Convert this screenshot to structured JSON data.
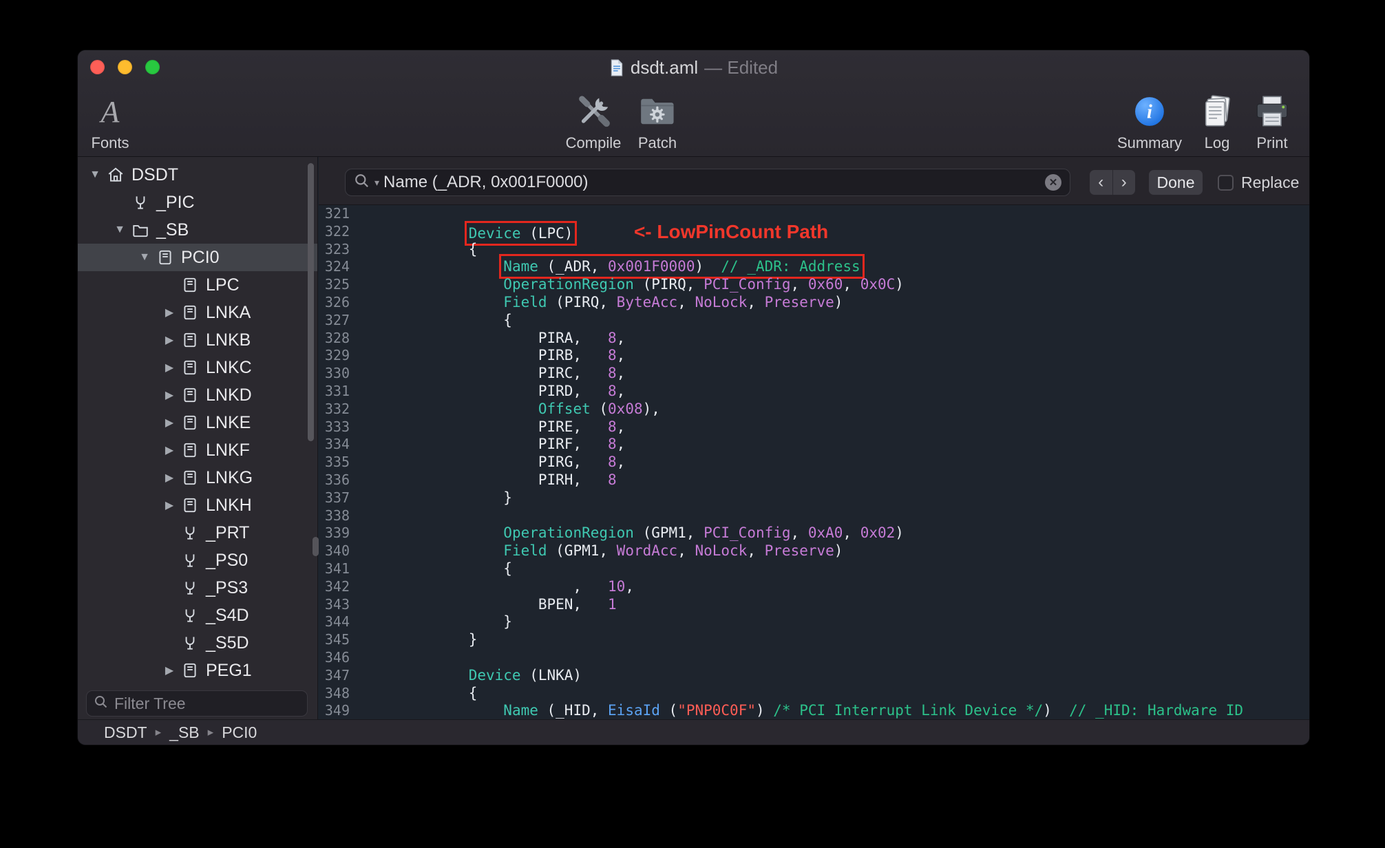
{
  "window": {
    "filename": "dsdt.aml",
    "edited_suffix": "— Edited"
  },
  "toolbar": {
    "fonts": "Fonts",
    "compile": "Compile",
    "patch": "Patch",
    "summary": "Summary",
    "log": "Log",
    "print": "Print"
  },
  "findbar": {
    "query": "Name (_ADR, 0x001F0000)",
    "done": "Done",
    "replace": "Replace",
    "replace_checked": false
  },
  "icons": {
    "search_caret": "▾",
    "clear": "✕",
    "find_prev": "‹",
    "find_next": "›",
    "disclosure_open": "▼",
    "disclosure_closed": "▶",
    "crumb_separator": "▸",
    "fonts_glyph": "A"
  },
  "sidebar": {
    "filter_placeholder": "Filter Tree",
    "breadcrumb": [
      "DSDT",
      "_SB",
      "PCI0"
    ],
    "items": [
      {
        "label": "DSDT",
        "level": 0,
        "disclosure": "open",
        "icon": "house-icon",
        "selected": false
      },
      {
        "label": "_PIC",
        "level": 1,
        "disclosure": "none",
        "icon": "method-icon",
        "selected": false
      },
      {
        "label": "_SB",
        "level": 1,
        "disclosure": "open",
        "icon": "folder-icon",
        "selected": false
      },
      {
        "label": "PCI0",
        "level": 2,
        "disclosure": "open",
        "icon": "device-icon",
        "selected": true
      },
      {
        "label": "LPC",
        "level": 3,
        "disclosure": "none",
        "icon": "device-icon",
        "selected": false
      },
      {
        "label": "LNKA",
        "level": 3,
        "disclosure": "closed",
        "icon": "device-icon",
        "selected": false
      },
      {
        "label": "LNKB",
        "level": 3,
        "disclosure": "closed",
        "icon": "device-icon",
        "selected": false
      },
      {
        "label": "LNKC",
        "level": 3,
        "disclosure": "closed",
        "icon": "device-icon",
        "selected": false
      },
      {
        "label": "LNKD",
        "level": 3,
        "disclosure": "closed",
        "icon": "device-icon",
        "selected": false
      },
      {
        "label": "LNKE",
        "level": 3,
        "disclosure": "closed",
        "icon": "device-icon",
        "selected": false
      },
      {
        "label": "LNKF",
        "level": 3,
        "disclosure": "closed",
        "icon": "device-icon",
        "selected": false
      },
      {
        "label": "LNKG",
        "level": 3,
        "disclosure": "closed",
        "icon": "device-icon",
        "selected": false
      },
      {
        "label": "LNKH",
        "level": 3,
        "disclosure": "closed",
        "icon": "device-icon",
        "selected": false
      },
      {
        "label": "_PRT",
        "level": 3,
        "disclosure": "none",
        "icon": "method-icon",
        "selected": false
      },
      {
        "label": "_PS0",
        "level": 3,
        "disclosure": "none",
        "icon": "method-icon",
        "selected": false
      },
      {
        "label": "_PS3",
        "level": 3,
        "disclosure": "none",
        "icon": "method-icon",
        "selected": false
      },
      {
        "label": "_S4D",
        "level": 3,
        "disclosure": "none",
        "icon": "method-icon",
        "selected": false
      },
      {
        "label": "_S5D",
        "level": 3,
        "disclosure": "none",
        "icon": "method-icon",
        "selected": false
      },
      {
        "label": "PEG1",
        "level": 3,
        "disclosure": "closed",
        "icon": "device-icon",
        "selected": false
      }
    ]
  },
  "editor": {
    "colors": {
      "keyword": "#3fc8b1",
      "constant": "#c67bd6",
      "comment": "#2cc18a",
      "string": "#ff5d55",
      "operator": "#5ba2f2",
      "highlight_box": "#e3271e",
      "annotation": "#f1372b"
    },
    "lines": [
      {
        "n": 321,
        "segs": []
      },
      {
        "n": 322,
        "segs": [
          {
            "t": "            "
          },
          {
            "c": "redbox",
            "segs": [
              {
                "t": "Device",
                "c": "kw"
              },
              {
                "t": " (LPC)"
              }
            ]
          },
          {
            "t": "       "
          },
          {
            "t": "<- LowPinCount Path",
            "c": "ann"
          }
        ]
      },
      {
        "n": 323,
        "segs": [
          {
            "t": "            {"
          }
        ]
      },
      {
        "n": 324,
        "segs": [
          {
            "t": "                "
          },
          {
            "c": "redbox",
            "segs": [
              {
                "t": "Name",
                "c": "kw"
              },
              {
                "t": " (_ADR, "
              },
              {
                "t": "0x001F0000",
                "c": "const"
              },
              {
                "t": ")  "
              },
              {
                "t": "// _ADR: Address",
                "c": "cm"
              }
            ]
          }
        ]
      },
      {
        "n": 325,
        "segs": [
          {
            "t": "                "
          },
          {
            "t": "OperationRegion",
            "c": "kw"
          },
          {
            "t": " (PIRQ, "
          },
          {
            "t": "PCI_Config",
            "c": "const"
          },
          {
            "t": ", "
          },
          {
            "t": "0x60",
            "c": "const"
          },
          {
            "t": ", "
          },
          {
            "t": "0x0C",
            "c": "const"
          },
          {
            "t": ")"
          }
        ]
      },
      {
        "n": 326,
        "segs": [
          {
            "t": "                "
          },
          {
            "t": "Field",
            "c": "kw"
          },
          {
            "t": " (PIRQ, "
          },
          {
            "t": "ByteAcc",
            "c": "const"
          },
          {
            "t": ", "
          },
          {
            "t": "NoLock",
            "c": "const"
          },
          {
            "t": ", "
          },
          {
            "t": "Preserve",
            "c": "const"
          },
          {
            "t": ")"
          }
        ]
      },
      {
        "n": 327,
        "segs": [
          {
            "t": "                {"
          }
        ]
      },
      {
        "n": 328,
        "segs": [
          {
            "t": "                    PIRA,   "
          },
          {
            "t": "8",
            "c": "const"
          },
          {
            "t": ","
          }
        ]
      },
      {
        "n": 329,
        "segs": [
          {
            "t": "                    PIRB,   "
          },
          {
            "t": "8",
            "c": "const"
          },
          {
            "t": ","
          }
        ]
      },
      {
        "n": 330,
        "segs": [
          {
            "t": "                    PIRC,   "
          },
          {
            "t": "8",
            "c": "const"
          },
          {
            "t": ","
          }
        ]
      },
      {
        "n": 331,
        "segs": [
          {
            "t": "                    PIRD,   "
          },
          {
            "t": "8",
            "c": "const"
          },
          {
            "t": ","
          }
        ]
      },
      {
        "n": 332,
        "segs": [
          {
            "t": "                    "
          },
          {
            "t": "Offset",
            "c": "kw"
          },
          {
            "t": " ("
          },
          {
            "t": "0x08",
            "c": "const"
          },
          {
            "t": "),"
          }
        ]
      },
      {
        "n": 333,
        "segs": [
          {
            "t": "                    PIRE,   "
          },
          {
            "t": "8",
            "c": "const"
          },
          {
            "t": ","
          }
        ]
      },
      {
        "n": 334,
        "segs": [
          {
            "t": "                    PIRF,   "
          },
          {
            "t": "8",
            "c": "const"
          },
          {
            "t": ","
          }
        ]
      },
      {
        "n": 335,
        "segs": [
          {
            "t": "                    PIRG,   "
          },
          {
            "t": "8",
            "c": "const"
          },
          {
            "t": ","
          }
        ]
      },
      {
        "n": 336,
        "segs": [
          {
            "t": "                    PIRH,   "
          },
          {
            "t": "8",
            "c": "const"
          }
        ]
      },
      {
        "n": 337,
        "segs": [
          {
            "t": "                }"
          }
        ]
      },
      {
        "n": 338,
        "segs": []
      },
      {
        "n": 339,
        "segs": [
          {
            "t": "                "
          },
          {
            "t": "OperationRegion",
            "c": "kw"
          },
          {
            "t": " (GPM1, "
          },
          {
            "t": "PCI_Config",
            "c": "const"
          },
          {
            "t": ", "
          },
          {
            "t": "0xA0",
            "c": "const"
          },
          {
            "t": ", "
          },
          {
            "t": "0x02",
            "c": "const"
          },
          {
            "t": ")"
          }
        ]
      },
      {
        "n": 340,
        "segs": [
          {
            "t": "                "
          },
          {
            "t": "Field",
            "c": "kw"
          },
          {
            "t": " (GPM1, "
          },
          {
            "t": "WordAcc",
            "c": "const"
          },
          {
            "t": ", "
          },
          {
            "t": "NoLock",
            "c": "const"
          },
          {
            "t": ", "
          },
          {
            "t": "Preserve",
            "c": "const"
          },
          {
            "t": ")"
          }
        ]
      },
      {
        "n": 341,
        "segs": [
          {
            "t": "                {"
          }
        ]
      },
      {
        "n": 342,
        "segs": [
          {
            "t": "                        ,   "
          },
          {
            "t": "10",
            "c": "const"
          },
          {
            "t": ","
          }
        ]
      },
      {
        "n": 343,
        "segs": [
          {
            "t": "                    BPEN,   "
          },
          {
            "t": "1",
            "c": "const"
          }
        ]
      },
      {
        "n": 344,
        "segs": [
          {
            "t": "                }"
          }
        ]
      },
      {
        "n": 345,
        "segs": [
          {
            "t": "            }"
          }
        ]
      },
      {
        "n": 346,
        "segs": []
      },
      {
        "n": 347,
        "segs": [
          {
            "t": "            "
          },
          {
            "t": "Device",
            "c": "kw"
          },
          {
            "t": " (LNKA)"
          }
        ]
      },
      {
        "n": 348,
        "segs": [
          {
            "t": "            {"
          }
        ]
      },
      {
        "n": 349,
        "segs": [
          {
            "t": "                "
          },
          {
            "t": "Name",
            "c": "kw"
          },
          {
            "t": " (_HID, "
          },
          {
            "t": "EisaId",
            "c": "op"
          },
          {
            "t": " ("
          },
          {
            "t": "\"PNP0C0F\"",
            "c": "str"
          },
          {
            "t": ") "
          },
          {
            "t": "/* PCI Interrupt Link Device */",
            "c": "cm"
          },
          {
            "t": ")  "
          },
          {
            "t": "// _HID: Hardware ID",
            "c": "cm"
          }
        ]
      }
    ]
  }
}
